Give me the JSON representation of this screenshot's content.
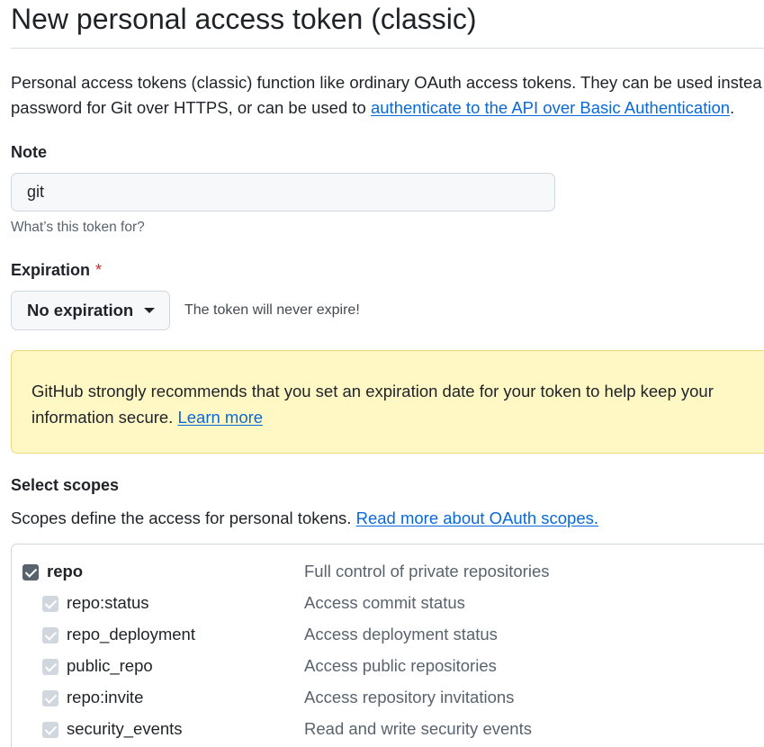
{
  "page": {
    "title": "New personal access token (classic)"
  },
  "intro": {
    "text_before": "Personal access tokens (classic) function like ordinary OAuth access tokens. They can be used instea",
    "text_line2": "password for Git over HTTPS, or can be used to ",
    "link": "authenticate to the API over Basic Authentication",
    "text_after": "."
  },
  "note": {
    "label": "Note",
    "value": "git",
    "hint": "What’s this token for?"
  },
  "expiration": {
    "label": "Expiration",
    "required_marker": "*",
    "selected": "No expiration",
    "hint": "The token will never expire!"
  },
  "warning": {
    "text": "GitHub strongly recommends that you set an expiration date for your token to help keep your information secure. ",
    "link": "Learn more"
  },
  "scopes": {
    "label": "Select scopes",
    "description": "Scopes define the access for personal tokens. ",
    "link": "Read more about OAuth scopes.",
    "items": [
      {
        "name": "repo",
        "description": "Full control of private repositories",
        "checked": true,
        "level": "main"
      },
      {
        "name": "repo:status",
        "description": "Access commit status",
        "checked": true,
        "level": "sub"
      },
      {
        "name": "repo_deployment",
        "description": "Access deployment status",
        "checked": true,
        "level": "sub"
      },
      {
        "name": "public_repo",
        "description": "Access public repositories",
        "checked": true,
        "level": "sub"
      },
      {
        "name": "repo:invite",
        "description": "Access repository invitations",
        "checked": true,
        "level": "sub"
      },
      {
        "name": "security_events",
        "description": "Read and write security events",
        "checked": true,
        "level": "sub"
      }
    ]
  },
  "colors": {
    "link": "#0969da",
    "warning_bg": "#fff8c5",
    "required": "#d1242f",
    "checkbox_checked": "#59636e",
    "checkbox_disabled": "#d0d7de"
  }
}
